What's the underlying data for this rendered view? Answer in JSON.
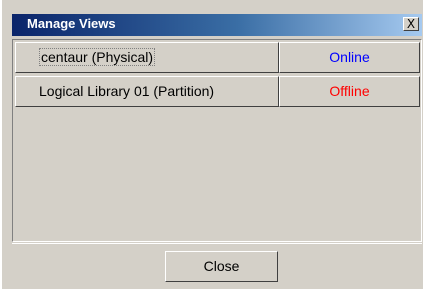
{
  "window": {
    "title": "Manage Views",
    "close_glyph": "X"
  },
  "views": [
    {
      "name": "centaur (Physical)",
      "status": "Online",
      "status_color": "#0000ff"
    },
    {
      "name": "Logical Library 01 (Partition)",
      "status": "Offline",
      "status_color": "#ff0000"
    }
  ],
  "footer": {
    "close_label": "Close"
  }
}
